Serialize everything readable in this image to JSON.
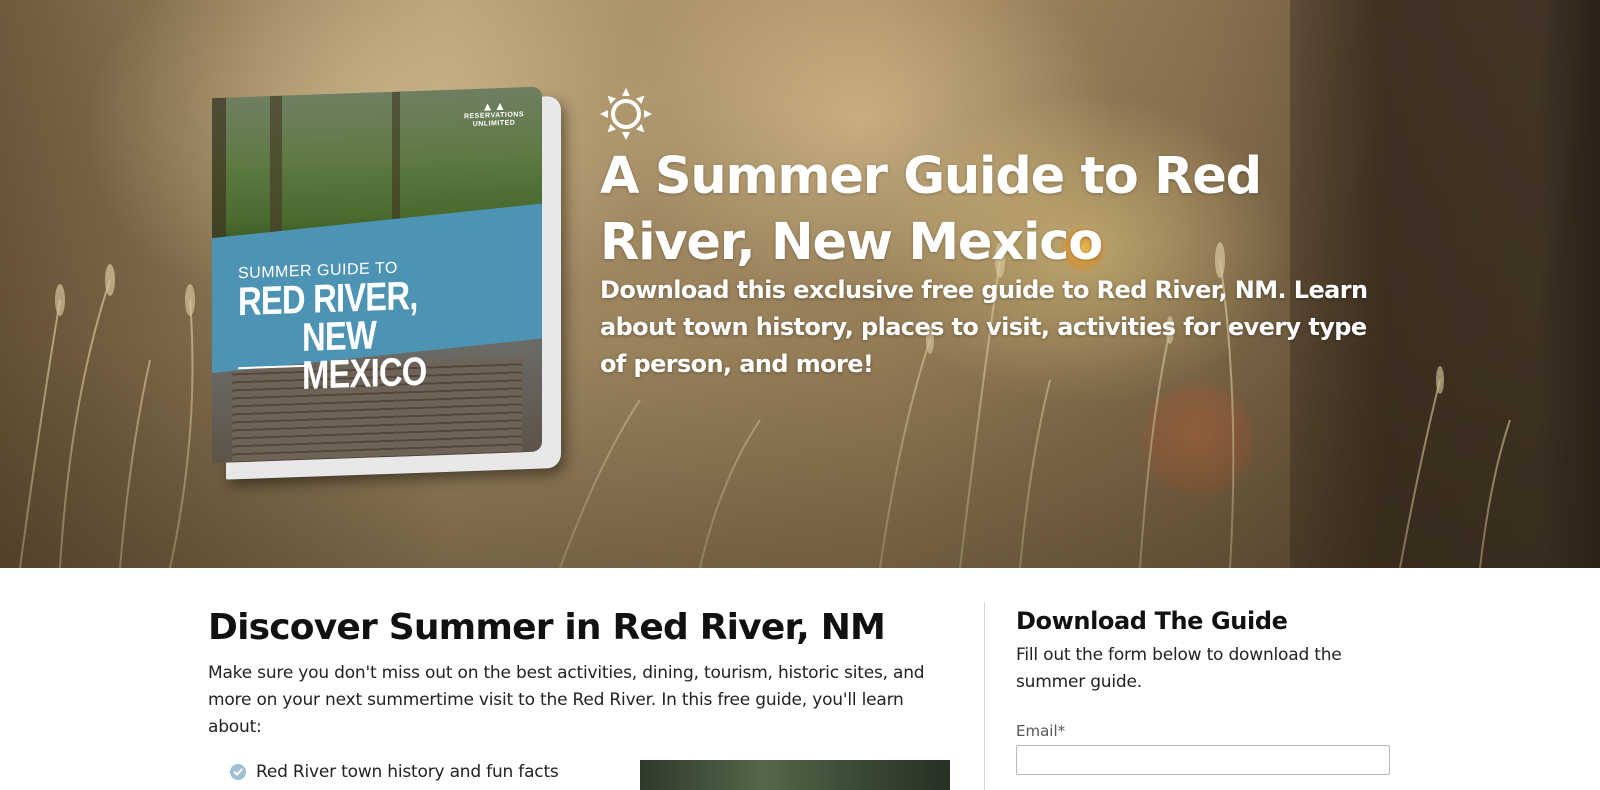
{
  "hero": {
    "title": "A Summer Guide to Red River, New Mexico",
    "subtitle": "Download this exclusive free guide to Red River, NM. Learn about town history, places to visit, activities for every type of person, and more!",
    "icon": "sun-icon"
  },
  "guide_cover": {
    "logo_line1": "RESERVATIONS",
    "logo_line2": "UNLIMITED",
    "subtitle": "SUMMER GUIDE TO",
    "title_line1": "RED RIVER,",
    "title_line2": "NEW MEXICO",
    "band_color": "#4d94b4"
  },
  "main": {
    "heading": "Discover Summer in Red River, NM",
    "body": "Make sure you don't miss out on the best activities, dining, tourism, historic sites, and more on your next summertime visit to the Red River. In this free guide, you'll learn about:",
    "benefits": [
      "Red River town history and fun facts"
    ]
  },
  "form": {
    "title": "Download The Guide",
    "description": "Fill out the form below to download the summer guide.",
    "email_label": "Email*",
    "email_value": ""
  },
  "colors": {
    "check": "#9fbfd3",
    "text": "#111111"
  }
}
